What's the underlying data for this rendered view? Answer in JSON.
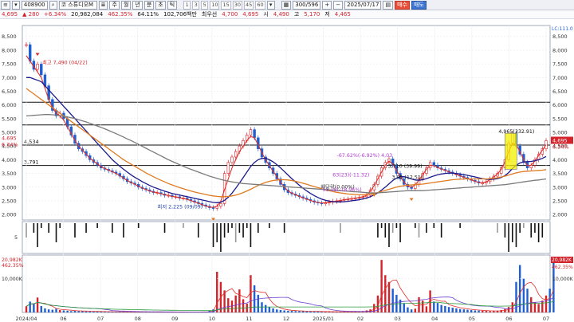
{
  "toolbar": {
    "stock_code": "408900",
    "stock_name": "코 스튜디오M",
    "view_buttons": [
      "주",
      "월",
      "년",
      "분",
      "초",
      "틱"
    ],
    "periods": [
      "1",
      "3",
      "5",
      "10",
      "15",
      "30",
      "45",
      "60"
    ],
    "count": "300/596",
    "date": "2025/07/17",
    "buy_label": "매수",
    "sell_label": "매도"
  },
  "infobar": {
    "price": "4,695",
    "change": "▲ 280",
    "change_pct": "+6.34%",
    "volume": "20,982,084",
    "vol_ratio": "462.35%",
    "turnover": "64.11%",
    "amount": "102,706백만",
    "prev_label": "최우선",
    "prev_value": "4,700",
    "last_value": "4,695",
    "open_label": "시",
    "open": "4,490",
    "high_label": "고",
    "high": "5,170",
    "low_label": "저",
    "low": "4,465"
  },
  "colors": {
    "up": "#d3242c",
    "down": "#1f5fd1",
    "ma5": "#e0302a",
    "ma20": "#1a1a8c",
    "ma60": "#e07a20",
    "ma120": "#7a7a7a"
  },
  "chart_data": [
    {
      "type": "candlestick",
      "title": "",
      "x_labels": [
        "2024/04",
        "06",
        "07",
        "08",
        "09",
        "10",
        "11",
        "12",
        "2025/01",
        "02",
        "03",
        "04",
        "05",
        "06",
        "07"
      ],
      "ylim": [
        1800,
        8900
      ],
      "y_ticks": [
        "8,500",
        "8,000",
        "7,500",
        "7,000",
        "6,500",
        "6,000",
        "5,500",
        "5,000",
        "4,500",
        "4,000",
        "3,500",
        "3,000",
        "2,500",
        "2,000"
      ],
      "price_tags": [
        "4,695",
        "6.34%"
      ],
      "left_labels": [
        "4,695",
        "6.34%"
      ],
      "right_top": "LC:111.0 HC:-37.3",
      "horizontal_lines": [
        6100,
        5270,
        4534,
        3791
      ],
      "line_labels": [
        "4,534",
        "3,791"
      ],
      "annotations": [
        {
          "text": "최고 7,490 (04/22)",
          "x": "2024/04/22",
          "y": 7490
        },
        {
          "text": "최저 2,225 (09/09)",
          "x": "2024/09/09",
          "y": 2225
        },
        {
          "text": "4,965(332.91)",
          "x": "2025/07/01",
          "y": 4965
        },
        {
          "text": "-67.62%(-6.92%) 4,03",
          "x": "2025/02/20",
          "y": 4100
        },
        {
          "text": "3,710 (39.99)",
          "x": "2025/03/05",
          "y": 3710
        },
        {
          "text": "63(23)(-11.32)",
          "x": "2025/02/14",
          "y": 3380
        },
        {
          "text": "51.18(-18.96%)",
          "x": "2025/02/10",
          "y": 2850
        },
        {
          "text": "배당락(0.00%)",
          "x": "2025/01/06",
          "y": 2950
        },
        {
          "text": "3.95 (12.51)",
          "x": "2025/03/10",
          "y": 3300
        }
      ],
      "close_series": [
        8200,
        7600,
        7300,
        7490,
        7100,
        6700,
        6200,
        5800,
        5600,
        5700,
        5500,
        5200,
        4900,
        4600,
        4400,
        4300,
        4150,
        4000,
        3900,
        3800,
        3700,
        3650,
        3600,
        3550,
        3500,
        3400,
        3300,
        3200,
        3150,
        3100,
        3000,
        2950,
        2900,
        2850,
        2800,
        2800,
        2750,
        2700,
        2700,
        2650,
        2650,
        2600,
        2600,
        2550,
        2500,
        2450,
        2400,
        2350,
        2300,
        2250,
        2225,
        2300,
        2400,
        3500,
        3900,
        4100,
        4300,
        4500,
        4700,
        4900,
        5100,
        4800,
        4400,
        4100,
        3900,
        3700,
        3500,
        3300,
        3100,
        2900,
        2800,
        2750,
        2700,
        2650,
        2600,
        2550,
        2500,
        2450,
        2420,
        2400,
        2420,
        2450,
        2480,
        2500,
        2520,
        2550,
        2560,
        2580,
        2600,
        2620,
        2650,
        2700,
        2900,
        3100,
        3400,
        3710,
        3900,
        4030,
        3800,
        3500,
        3300,
        3100,
        3000,
        2950,
        3100,
        3300,
        3500,
        3700,
        3900,
        3800,
        3700,
        3650,
        3600,
        3550,
        3500,
        3450,
        3400,
        3350,
        3300,
        3250,
        3200,
        3150,
        3150,
        3200,
        3300,
        3400,
        3500,
        3700,
        4000,
        4600,
        4965,
        4500,
        4200,
        3900,
        3700,
        3800,
        4000,
        4200,
        4400,
        4695
      ],
      "ma_series": [
        {
          "name": "5",
          "values": [
            7800,
            7600,
            7400,
            7200,
            7000,
            6600,
            6200,
            5900,
            5700,
            5600,
            5450,
            5200,
            4950,
            4700,
            4500,
            4350,
            4200,
            4050,
            3950,
            3850,
            3750,
            3680,
            3620,
            3560,
            3500,
            3420,
            3330,
            3240,
            3170,
            3110,
            3030,
            2970,
            2910,
            2860,
            2820,
            2800,
            2760,
            2720,
            2700,
            2660,
            2640,
            2610,
            2590,
            2550,
            2510,
            2460,
            2410,
            2360,
            2310,
            2270,
            2260,
            2300,
            2480,
            2900,
            3300,
            3700,
            4000,
            4300,
            4500,
            4700,
            4850,
            4800,
            4550,
            4250,
            4000,
            3780,
            3580,
            3380,
            3180,
            3000,
            2860,
            2780,
            2720,
            2660,
            2610,
            2560,
            2510,
            2470,
            2440,
            2420,
            2430,
            2450,
            2470,
            2490,
            2510,
            2540,
            2560,
            2580,
            2600,
            2620,
            2650,
            2700,
            2850,
            3050,
            3300,
            3550,
            3800,
            3950,
            3850,
            3600,
            3380,
            3180,
            3050,
            3000,
            3080,
            3250,
            3450,
            3650,
            3800,
            3780,
            3720,
            3660,
            3610,
            3560,
            3510,
            3460,
            3410,
            3360,
            3310,
            3260,
            3210,
            3170,
            3160,
            3190,
            3270,
            3370,
            3480,
            3650,
            3920,
            4300,
            4600,
            4550,
            4300,
            4000,
            3780,
            3800,
            3950,
            4150,
            4350,
            4550
          ]
        },
        {
          "name": "20",
          "values": [
            7000,
            7000,
            6950,
            6900,
            6850,
            6700,
            6550,
            6400,
            6250,
            6100,
            5950,
            5800,
            5650,
            5500,
            5350,
            5200,
            5050,
            4900,
            4750,
            4600,
            4450,
            4300,
            4150,
            4000,
            3880,
            3760,
            3650,
            3550,
            3450,
            3360,
            3280,
            3200,
            3130,
            3060,
            3000,
            2950,
            2900,
            2850,
            2810,
            2770,
            2740,
            2710,
            2680,
            2650,
            2620,
            2590,
            2560,
            2530,
            2500,
            2470,
            2440,
            2430,
            2450,
            2520,
            2630,
            2780,
            2960,
            3150,
            3350,
            3550,
            3750,
            3900,
            4000,
            4050,
            4050,
            4000,
            3920,
            3820,
            3700,
            3570,
            3440,
            3310,
            3190,
            3070,
            2960,
            2860,
            2770,
            2690,
            2620,
            2560,
            2520,
            2490,
            2470,
            2460,
            2460,
            2470,
            2480,
            2500,
            2520,
            2540,
            2570,
            2600,
            2650,
            2710,
            2790,
            2890,
            3000,
            3120,
            3240,
            3330,
            3380,
            3380,
            3350,
            3300,
            3260,
            3250,
            3270,
            3310,
            3360,
            3410,
            3450,
            3480,
            3500,
            3510,
            3510,
            3500,
            3480,
            3460,
            3430,
            3400,
            3370,
            3340,
            3310,
            3290,
            3280,
            3290,
            3310,
            3350,
            3420,
            3530,
            3680,
            3800,
            3880,
            3920,
            3930,
            3940,
            3960,
            4000,
            4050,
            4120
          ]
        },
        {
          "name": "60",
          "values": [
            6600,
            6500,
            6400,
            6300,
            6200,
            6100,
            6000,
            5900,
            5800,
            5700,
            5600,
            5500,
            5400,
            5300,
            5200,
            5100,
            5000,
            4900,
            4800,
            4700,
            4600,
            4500,
            4400,
            4300,
            4200,
            4100,
            4000,
            3920,
            3840,
            3760,
            3680,
            3600,
            3520,
            3450,
            3380,
            3310,
            3250,
            3190,
            3130,
            3080,
            3030,
            2980,
            2940,
            2900,
            2860,
            2820,
            2790,
            2760,
            2730,
            2700,
            2680,
            2660,
            2650,
            2650,
            2660,
            2680,
            2710,
            2750,
            2800,
            2860,
            2920,
            2990,
            3060,
            3120,
            3170,
            3210,
            3240,
            3260,
            3270,
            3270,
            3260,
            3240,
            3210,
            3180,
            3140,
            3100,
            3060,
            3020,
            2980,
            2940,
            2900,
            2870,
            2840,
            2810,
            2790,
            2770,
            2750,
            2740,
            2730,
            2720,
            2720,
            2730,
            2750,
            2770,
            2800,
            2840,
            2880,
            2920,
            2960,
            3000,
            3030,
            3050,
            3070,
            3080,
            3090,
            3100,
            3110,
            3130,
            3150,
            3170,
            3190,
            3210,
            3230,
            3250,
            3270,
            3280,
            3290,
            3300,
            3300,
            3300,
            3300,
            3300,
            3300,
            3300,
            3310,
            3320,
            3340,
            3370,
            3400,
            3440,
            3480,
            3520,
            3550,
            3570,
            3580,
            3590,
            3600,
            3610,
            3620,
            3640
          ]
        },
        {
          "name": "120",
          "values": [
            5600,
            5610,
            5620,
            5630,
            5640,
            5650,
            5650,
            5640,
            5630,
            5610,
            5590,
            5560,
            5530,
            5500,
            5460,
            5420,
            5380,
            5330,
            5280,
            5230,
            5180,
            5130,
            5070,
            5010,
            4950,
            4890,
            4830,
            4760,
            4700,
            4630,
            4560,
            4490,
            4420,
            4350,
            4280,
            4210,
            4140,
            4070,
            4000,
            3940,
            3880,
            3820,
            3760,
            3700,
            3650,
            3600,
            3550,
            3500,
            3450,
            3400,
            3360,
            3320,
            3280,
            3250,
            3220,
            3190,
            3170,
            3150,
            3130,
            3120,
            3110,
            3100,
            3090,
            3080,
            3070,
            3060,
            3050,
            3040,
            3030,
            3020,
            3010,
            3000,
            2990,
            2980,
            2970,
            2960,
            2950,
            2940,
            2930,
            2920,
            2910,
            2900,
            2890,
            2880,
            2870,
            2860,
            2850,
            2840,
            2830,
            2820,
            2810,
            2800,
            2790,
            2790,
            2790,
            2800,
            2810,
            2820,
            2830,
            2840,
            2850,
            2860,
            2870,
            2870,
            2870,
            2870,
            2870,
            2880,
            2890,
            2900,
            2910,
            2920,
            2930,
            2940,
            2950,
            2960,
            2970,
            2980,
            2990,
            3000,
            3010,
            3020,
            3030,
            3040,
            3050,
            3060,
            3070,
            3080,
            3090,
            3110,
            3130,
            3150,
            3170,
            3190,
            3210,
            3230,
            3250,
            3260,
            3280,
            3300
          ]
        }
      ]
    },
    {
      "type": "bar",
      "title": "",
      "y_ticks": [
        "5"
      ],
      "values": [
        3,
        0,
        2,
        5,
        1,
        0,
        2,
        0,
        4,
        1,
        0,
        0,
        0,
        3,
        0,
        0,
        2,
        0,
        0,
        1,
        0,
        0,
        0,
        2,
        0,
        0,
        3,
        0,
        0,
        0,
        1,
        0,
        0,
        0,
        0,
        0,
        0,
        2,
        0,
        0,
        0,
        0,
        1,
        0,
        0,
        0,
        3,
        0,
        0,
        0,
        5,
        4,
        6,
        3,
        2,
        1,
        4,
        2,
        3,
        1,
        5,
        0,
        2,
        0,
        0,
        1,
        0,
        0,
        0,
        2,
        0,
        0,
        0,
        0,
        0,
        0,
        0,
        0,
        0,
        0,
        0,
        0,
        0,
        0,
        2,
        0,
        0,
        0,
        0,
        0,
        0,
        0,
        0,
        0,
        3,
        1,
        3,
        5,
        2,
        1,
        4,
        0,
        0,
        0,
        1,
        3,
        0,
        2,
        0,
        1,
        0,
        3,
        0,
        0,
        0,
        0,
        1,
        0,
        0,
        0,
        0,
        0,
        0,
        0,
        0,
        0,
        2,
        0,
        3,
        6,
        4,
        5,
        2,
        1,
        0,
        3,
        2,
        4,
        3
      ]
    },
    {
      "type": "bar",
      "title": "",
      "labels": [
        "20,982K",
        "462.35%"
      ],
      "y_ticks": [
        "10,000K"
      ],
      "values": [
        1800,
        3200,
        2600,
        4400,
        1900,
        1200,
        900,
        800,
        1100,
        700,
        600,
        500,
        400,
        500,
        400,
        350,
        300,
        300,
        280,
        260,
        240,
        220,
        200,
        210,
        190,
        180,
        170,
        160,
        150,
        150,
        140,
        140,
        130,
        130,
        120,
        120,
        110,
        110,
        100,
        100,
        100,
        95,
        95,
        90,
        90,
        90,
        85,
        85,
        80,
        600,
        900,
        12000,
        9000,
        6500,
        4200,
        3500,
        5000,
        6800,
        3900,
        2600,
        11000,
        8000,
        5200,
        3000,
        2200,
        1600,
        1200,
        900,
        700,
        600,
        500,
        450,
        400,
        380,
        350,
        320,
        300,
        280,
        260,
        250,
        240,
        230,
        220,
        210,
        200,
        200,
        190,
        190,
        180,
        180,
        400,
        600,
        900,
        2500,
        5000,
        15500,
        11000,
        9000,
        7000,
        5200,
        3800,
        2600,
        1500,
        900,
        1100,
        4500,
        3500,
        1800,
        6500,
        3200,
        2800,
        2200,
        1900,
        1600,
        1400,
        1200,
        1000,
        900,
        800,
        700,
        600,
        550,
        500,
        450,
        400,
        420,
        500,
        700,
        1000,
        1600,
        3000,
        9000,
        14000,
        10000,
        7000,
        4500,
        3000,
        2500,
        3500,
        5000,
        7000,
        15000
      ]
    }
  ]
}
